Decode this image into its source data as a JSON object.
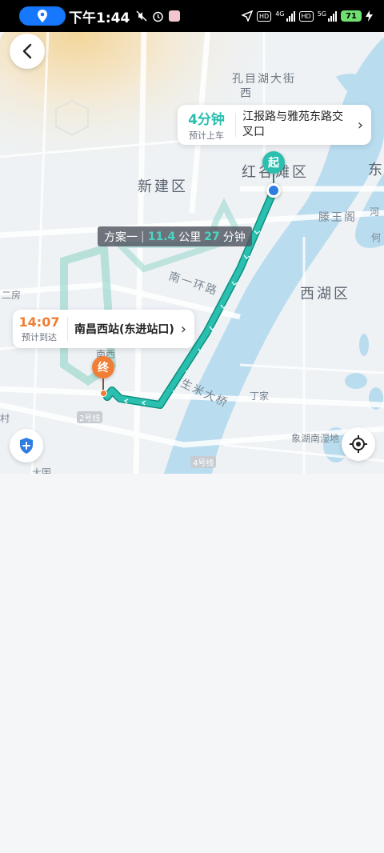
{
  "status_bar": {
    "time": "下午1:44",
    "network_1": "4G",
    "network_2": "5G",
    "hd_label": "HD",
    "battery": "71",
    "icons": [
      "location-icon",
      "mute-icon",
      "alarm-icon",
      "app-icon",
      "navigation-icon",
      "signal-icon",
      "charging-icon"
    ]
  },
  "map": {
    "labels": {
      "district_xinjian": "新建区",
      "district_honggutan": "红谷滩区",
      "district_xihu": "西湖区",
      "east": "东",
      "west": "西",
      "kongmu": "孔目湖大街",
      "tengwang": "滕王阁",
      "ring_road": "南一环路",
      "niumi_bridge": "生米大桥",
      "dingjia": "丁家",
      "wetland": "象湖南湿地",
      "line2": "2号线",
      "line4": "4号线",
      "er_fang": "二房",
      "cun": "村",
      "he": "河",
      "he_g": "何",
      "dawei": "大围",
      "nanxi": "南西"
    }
  },
  "pickup": {
    "eta": "4分钟",
    "eta_label": "预计上车",
    "address": "江报路与雅苑东路交叉口"
  },
  "route_tag": {
    "plan": "方案一",
    "distance": "11.4",
    "distance_unit": "公里",
    "duration": "27",
    "duration_unit": "分钟"
  },
  "arrival": {
    "time": "14:07",
    "label": "预计到达",
    "destination": "南昌西站(东进站口)"
  },
  "markers": {
    "start": "起",
    "end": "终"
  },
  "colors": {
    "route": "#2bbfb0",
    "start": "#2bbfb0",
    "end": "#f07f35",
    "water": "#b9dcef"
  }
}
